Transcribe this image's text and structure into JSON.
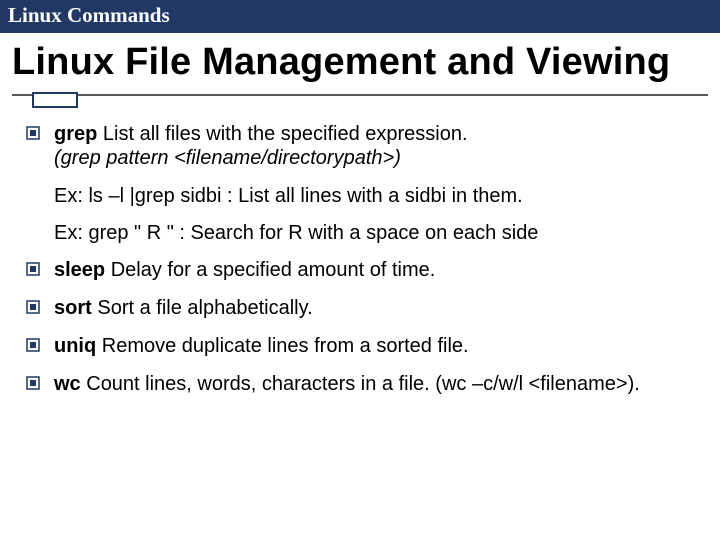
{
  "header": "Linux Commands",
  "title": "Linux File Management and Viewing",
  "items": {
    "grep": {
      "cmd": "grep",
      "desc": " List all files with the specified expression.",
      "syntax": "(grep pattern <filename/directorypath>)",
      "ex1": "Ex: ls –l |grep sidbi : List all lines with a sidbi in them.",
      "ex2": "Ex: grep \" R \" : Search for R with a space on each side"
    },
    "sleep": {
      "cmd": "sleep",
      "desc": " Delay for a specified amount of time."
    },
    "sort": {
      "cmd": "sort",
      "desc": " Sort a file alphabetically."
    },
    "uniq": {
      "cmd": "uniq",
      "desc": " Remove duplicate lines from a sorted file."
    },
    "wc": {
      "cmd": "wc",
      "desc": " Count lines, words, characters in a file. (wc –c/w/l <filename>)."
    }
  }
}
